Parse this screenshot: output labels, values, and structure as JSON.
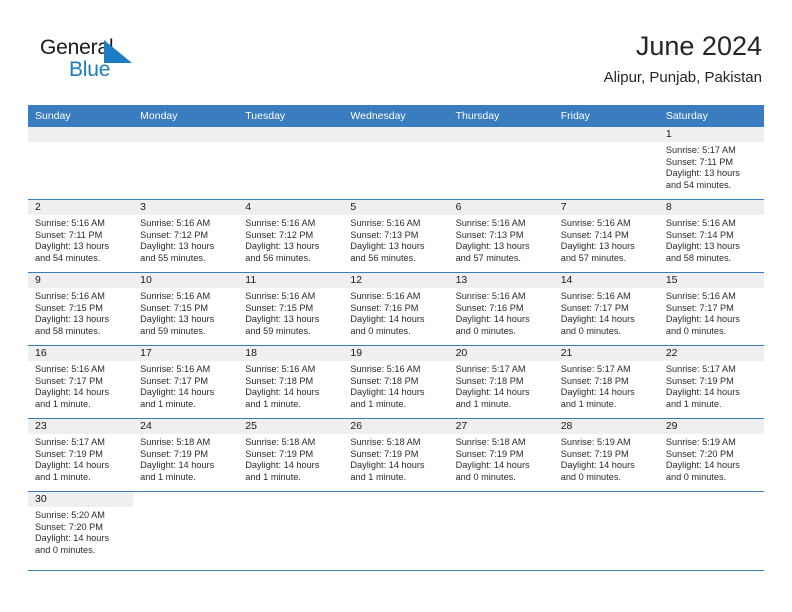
{
  "logo": {
    "text_primary": "General",
    "text_secondary": "Blue",
    "triangle_icon": "triangle-icon",
    "primary_color": "#1a1a1a",
    "secondary_color": "#1d7dc4"
  },
  "header": {
    "title": "June 2024",
    "subtitle": "Alipur, Punjab, Pakistan"
  },
  "theme": {
    "header_bg": "#3a7cc0",
    "header_text": "#ffffff",
    "daynum_bg": "#efefef",
    "rule_color": "#3a7cc0"
  },
  "weekdays": [
    "Sunday",
    "Monday",
    "Tuesday",
    "Wednesday",
    "Thursday",
    "Friday",
    "Saturday"
  ],
  "labels": {
    "sunrise": "Sunrise:",
    "sunset": "Sunset:",
    "daylight": "Daylight:"
  },
  "weeks": [
    [
      {
        "day": "",
        "sunrise": "",
        "sunset": "",
        "daylight_line1": "",
        "daylight_line2": "",
        "empty": true
      },
      {
        "day": "",
        "sunrise": "",
        "sunset": "",
        "daylight_line1": "",
        "daylight_line2": "",
        "empty": true
      },
      {
        "day": "",
        "sunrise": "",
        "sunset": "",
        "daylight_line1": "",
        "daylight_line2": "",
        "empty": true
      },
      {
        "day": "",
        "sunrise": "",
        "sunset": "",
        "daylight_line1": "",
        "daylight_line2": "",
        "empty": true
      },
      {
        "day": "",
        "sunrise": "",
        "sunset": "",
        "daylight_line1": "",
        "daylight_line2": "",
        "empty": true
      },
      {
        "day": "",
        "sunrise": "",
        "sunset": "",
        "daylight_line1": "",
        "daylight_line2": "",
        "empty": true
      },
      {
        "day": "1",
        "sunrise": "Sunrise: 5:17 AM",
        "sunset": "Sunset: 7:11 PM",
        "daylight_line1": "Daylight: 13 hours",
        "daylight_line2": "and 54 minutes.",
        "empty": false
      }
    ],
    [
      {
        "day": "2",
        "sunrise": "Sunrise: 5:16 AM",
        "sunset": "Sunset: 7:11 PM",
        "daylight_line1": "Daylight: 13 hours",
        "daylight_line2": "and 54 minutes.",
        "empty": false
      },
      {
        "day": "3",
        "sunrise": "Sunrise: 5:16 AM",
        "sunset": "Sunset: 7:12 PM",
        "daylight_line1": "Daylight: 13 hours",
        "daylight_line2": "and 55 minutes.",
        "empty": false
      },
      {
        "day": "4",
        "sunrise": "Sunrise: 5:16 AM",
        "sunset": "Sunset: 7:12 PM",
        "daylight_line1": "Daylight: 13 hours",
        "daylight_line2": "and 56 minutes.",
        "empty": false
      },
      {
        "day": "5",
        "sunrise": "Sunrise: 5:16 AM",
        "sunset": "Sunset: 7:13 PM",
        "daylight_line1": "Daylight: 13 hours",
        "daylight_line2": "and 56 minutes.",
        "empty": false
      },
      {
        "day": "6",
        "sunrise": "Sunrise: 5:16 AM",
        "sunset": "Sunset: 7:13 PM",
        "daylight_line1": "Daylight: 13 hours",
        "daylight_line2": "and 57 minutes.",
        "empty": false
      },
      {
        "day": "7",
        "sunrise": "Sunrise: 5:16 AM",
        "sunset": "Sunset: 7:14 PM",
        "daylight_line1": "Daylight: 13 hours",
        "daylight_line2": "and 57 minutes.",
        "empty": false
      },
      {
        "day": "8",
        "sunrise": "Sunrise: 5:16 AM",
        "sunset": "Sunset: 7:14 PM",
        "daylight_line1": "Daylight: 13 hours",
        "daylight_line2": "and 58 minutes.",
        "empty": false
      }
    ],
    [
      {
        "day": "9",
        "sunrise": "Sunrise: 5:16 AM",
        "sunset": "Sunset: 7:15 PM",
        "daylight_line1": "Daylight: 13 hours",
        "daylight_line2": "and 58 minutes.",
        "empty": false
      },
      {
        "day": "10",
        "sunrise": "Sunrise: 5:16 AM",
        "sunset": "Sunset: 7:15 PM",
        "daylight_line1": "Daylight: 13 hours",
        "daylight_line2": "and 59 minutes.",
        "empty": false
      },
      {
        "day": "11",
        "sunrise": "Sunrise: 5:16 AM",
        "sunset": "Sunset: 7:15 PM",
        "daylight_line1": "Daylight: 13 hours",
        "daylight_line2": "and 59 minutes.",
        "empty": false
      },
      {
        "day": "12",
        "sunrise": "Sunrise: 5:16 AM",
        "sunset": "Sunset: 7:16 PM",
        "daylight_line1": "Daylight: 14 hours",
        "daylight_line2": "and 0 minutes.",
        "empty": false
      },
      {
        "day": "13",
        "sunrise": "Sunrise: 5:16 AM",
        "sunset": "Sunset: 7:16 PM",
        "daylight_line1": "Daylight: 14 hours",
        "daylight_line2": "and 0 minutes.",
        "empty": false
      },
      {
        "day": "14",
        "sunrise": "Sunrise: 5:16 AM",
        "sunset": "Sunset: 7:17 PM",
        "daylight_line1": "Daylight: 14 hours",
        "daylight_line2": "and 0 minutes.",
        "empty": false
      },
      {
        "day": "15",
        "sunrise": "Sunrise: 5:16 AM",
        "sunset": "Sunset: 7:17 PM",
        "daylight_line1": "Daylight: 14 hours",
        "daylight_line2": "and 0 minutes.",
        "empty": false
      }
    ],
    [
      {
        "day": "16",
        "sunrise": "Sunrise: 5:16 AM",
        "sunset": "Sunset: 7:17 PM",
        "daylight_line1": "Daylight: 14 hours",
        "daylight_line2": "and 1 minute.",
        "empty": false
      },
      {
        "day": "17",
        "sunrise": "Sunrise: 5:16 AM",
        "sunset": "Sunset: 7:17 PM",
        "daylight_line1": "Daylight: 14 hours",
        "daylight_line2": "and 1 minute.",
        "empty": false
      },
      {
        "day": "18",
        "sunrise": "Sunrise: 5:16 AM",
        "sunset": "Sunset: 7:18 PM",
        "daylight_line1": "Daylight: 14 hours",
        "daylight_line2": "and 1 minute.",
        "empty": false
      },
      {
        "day": "19",
        "sunrise": "Sunrise: 5:16 AM",
        "sunset": "Sunset: 7:18 PM",
        "daylight_line1": "Daylight: 14 hours",
        "daylight_line2": "and 1 minute.",
        "empty": false
      },
      {
        "day": "20",
        "sunrise": "Sunrise: 5:17 AM",
        "sunset": "Sunset: 7:18 PM",
        "daylight_line1": "Daylight: 14 hours",
        "daylight_line2": "and 1 minute.",
        "empty": false
      },
      {
        "day": "21",
        "sunrise": "Sunrise: 5:17 AM",
        "sunset": "Sunset: 7:18 PM",
        "daylight_line1": "Daylight: 14 hours",
        "daylight_line2": "and 1 minute.",
        "empty": false
      },
      {
        "day": "22",
        "sunrise": "Sunrise: 5:17 AM",
        "sunset": "Sunset: 7:19 PM",
        "daylight_line1": "Daylight: 14 hours",
        "daylight_line2": "and 1 minute.",
        "empty": false
      }
    ],
    [
      {
        "day": "23",
        "sunrise": "Sunrise: 5:17 AM",
        "sunset": "Sunset: 7:19 PM",
        "daylight_line1": "Daylight: 14 hours",
        "daylight_line2": "and 1 minute.",
        "empty": false
      },
      {
        "day": "24",
        "sunrise": "Sunrise: 5:18 AM",
        "sunset": "Sunset: 7:19 PM",
        "daylight_line1": "Daylight: 14 hours",
        "daylight_line2": "and 1 minute.",
        "empty": false
      },
      {
        "day": "25",
        "sunrise": "Sunrise: 5:18 AM",
        "sunset": "Sunset: 7:19 PM",
        "daylight_line1": "Daylight: 14 hours",
        "daylight_line2": "and 1 minute.",
        "empty": false
      },
      {
        "day": "26",
        "sunrise": "Sunrise: 5:18 AM",
        "sunset": "Sunset: 7:19 PM",
        "daylight_line1": "Daylight: 14 hours",
        "daylight_line2": "and 1 minute.",
        "empty": false
      },
      {
        "day": "27",
        "sunrise": "Sunrise: 5:18 AM",
        "sunset": "Sunset: 7:19 PM",
        "daylight_line1": "Daylight: 14 hours",
        "daylight_line2": "and 0 minutes.",
        "empty": false
      },
      {
        "day": "28",
        "sunrise": "Sunrise: 5:19 AM",
        "sunset": "Sunset: 7:19 PM",
        "daylight_line1": "Daylight: 14 hours",
        "daylight_line2": "and 0 minutes.",
        "empty": false
      },
      {
        "day": "29",
        "sunrise": "Sunrise: 5:19 AM",
        "sunset": "Sunset: 7:20 PM",
        "daylight_line1": "Daylight: 14 hours",
        "daylight_line2": "and 0 minutes.",
        "empty": false
      }
    ],
    [
      {
        "day": "30",
        "sunrise": "Sunrise: 5:20 AM",
        "sunset": "Sunset: 7:20 PM",
        "daylight_line1": "Daylight: 14 hours",
        "daylight_line2": "and 0 minutes.",
        "empty": false
      },
      {
        "day": "",
        "sunrise": "",
        "sunset": "",
        "daylight_line1": "",
        "daylight_line2": "",
        "empty": true,
        "blank": true
      },
      {
        "day": "",
        "sunrise": "",
        "sunset": "",
        "daylight_line1": "",
        "daylight_line2": "",
        "empty": true,
        "blank": true
      },
      {
        "day": "",
        "sunrise": "",
        "sunset": "",
        "daylight_line1": "",
        "daylight_line2": "",
        "empty": true,
        "blank": true
      },
      {
        "day": "",
        "sunrise": "",
        "sunset": "",
        "daylight_line1": "",
        "daylight_line2": "",
        "empty": true,
        "blank": true
      },
      {
        "day": "",
        "sunrise": "",
        "sunset": "",
        "daylight_line1": "",
        "daylight_line2": "",
        "empty": true,
        "blank": true
      },
      {
        "day": "",
        "sunrise": "",
        "sunset": "",
        "daylight_line1": "",
        "daylight_line2": "",
        "empty": true,
        "blank": true
      }
    ]
  ]
}
